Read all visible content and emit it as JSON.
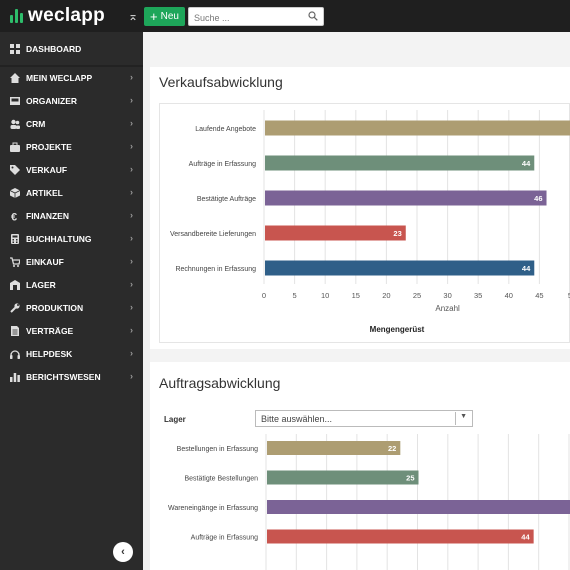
{
  "app": {
    "logo_text": "weclapp",
    "new_button_label": "Neu",
    "search_placeholder": "Suche ...",
    "brand_color": "#1ea65a"
  },
  "sidebar": {
    "items": [
      {
        "label": "DASHBOARD",
        "icon": "dashboard-icon",
        "chevron": false
      },
      {
        "label": "MEIN WECLAPP",
        "icon": "home-icon",
        "chevron": true
      },
      {
        "label": "ORGANIZER",
        "icon": "inbox-icon",
        "chevron": true
      },
      {
        "label": "CRM",
        "icon": "users-icon",
        "chevron": true
      },
      {
        "label": "PROJEKTE",
        "icon": "briefcase-icon",
        "chevron": true
      },
      {
        "label": "VERKAUF",
        "icon": "tag-icon",
        "chevron": true
      },
      {
        "label": "ARTIKEL",
        "icon": "cube-icon",
        "chevron": true
      },
      {
        "label": "FINANZEN",
        "icon": "euro-icon",
        "chevron": true
      },
      {
        "label": "BUCHHALTUNG",
        "icon": "calculator-icon",
        "chevron": true
      },
      {
        "label": "EINKAUF",
        "icon": "cart-icon",
        "chevron": true
      },
      {
        "label": "LAGER",
        "icon": "box-icon",
        "chevron": true
      },
      {
        "label": "PRODUKTION",
        "icon": "wrench-icon",
        "chevron": true
      },
      {
        "label": "VERTRÄGE",
        "icon": "document-icon",
        "chevron": true
      },
      {
        "label": "HELPDESK",
        "icon": "headset-icon",
        "chevron": true
      },
      {
        "label": "BERICHTSWESEN",
        "icon": "bar-chart-icon",
        "chevron": true
      }
    ]
  },
  "verkauf": {
    "title": "Verkaufsabwicklung",
    "chart_subtitle": "Mengengerüst"
  },
  "auftrag": {
    "title": "Auftragsabwicklung",
    "lager_label": "Lager",
    "lager_placeholder": "Bitte auswählen..."
  },
  "chart_data": [
    {
      "type": "bar",
      "orientation": "horizontal",
      "categories": [
        "Laufende Angebote",
        "Aufträge in Erfassung",
        "Bestätigte Aufträge",
        "Versandbereite Lieferungen",
        "Rechnungen in Erfassung"
      ],
      "values": [
        52,
        44,
        46,
        23,
        44
      ],
      "data_labels": [
        "",
        "44",
        "46",
        "23",
        "44"
      ],
      "colors": [
        "#ad9d72",
        "#6e8f7a",
        "#7b6396",
        "#c8554f",
        "#2f5f88"
      ],
      "xlabel": "Anzahl",
      "title": "Mengengerüst",
      "xticks": [
        "0",
        "5",
        "10",
        "15",
        "20",
        "25",
        "30",
        "35",
        "40",
        "45",
        "5"
      ],
      "xlim": [
        0,
        50
      ],
      "grid": true
    },
    {
      "type": "bar",
      "orientation": "horizontal",
      "categories": [
        "Bestellungen in Erfassung",
        "Bestätigte Bestellungen",
        "Wareneingänge in Erfassung",
        "Aufträge in Erfassung"
      ],
      "values": [
        22,
        25,
        52,
        44
      ],
      "data_labels": [
        "22",
        "25",
        "",
        "44"
      ],
      "colors": [
        "#ad9d72",
        "#6e8f7a",
        "#7b6396",
        "#c8554f"
      ],
      "xlim": [
        0,
        50
      ],
      "grid": true
    }
  ]
}
